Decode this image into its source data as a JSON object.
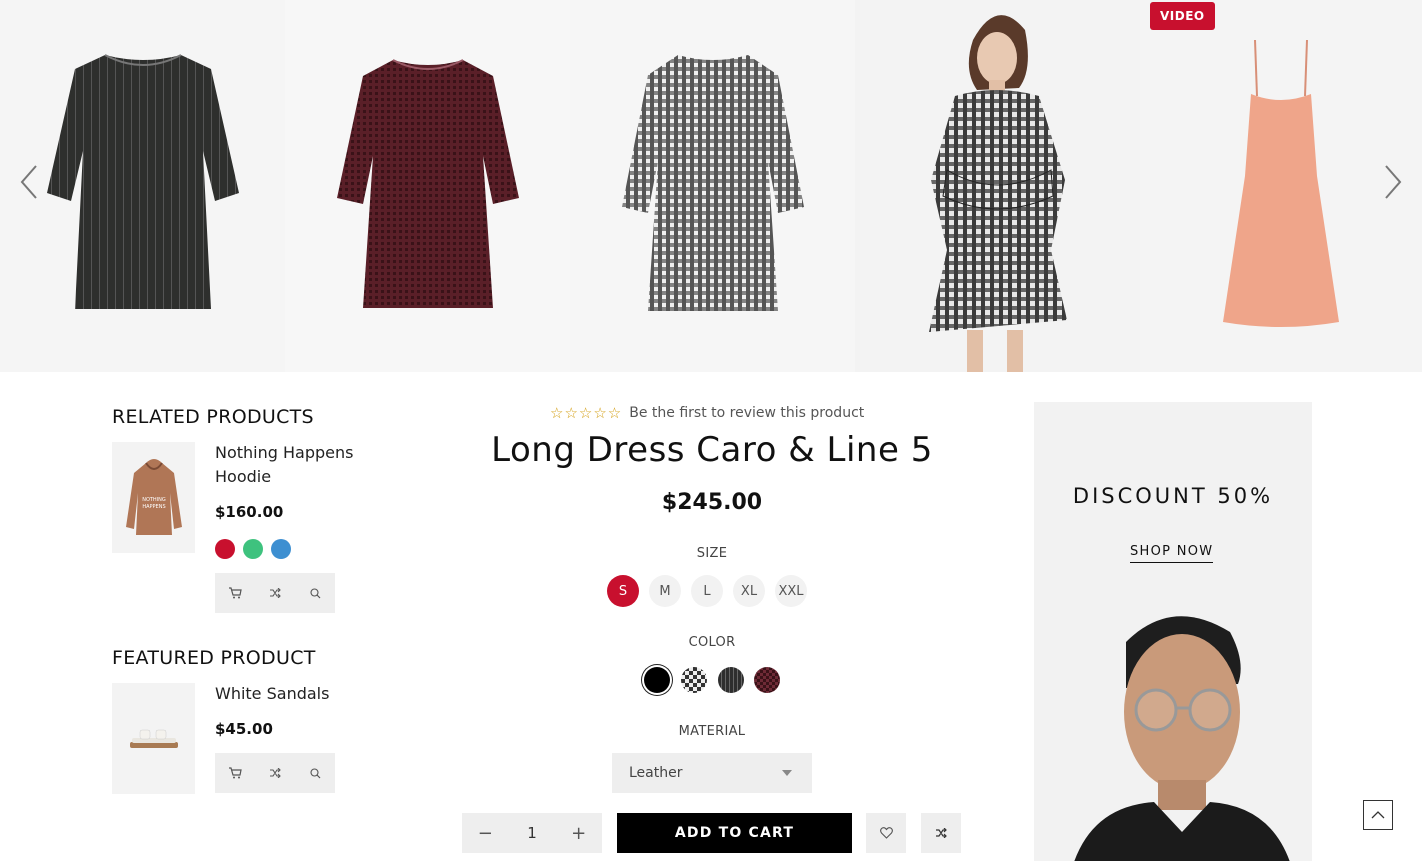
{
  "gallery": {
    "video_badge": "VIDEO",
    "slides": [
      "dress-black-stripe",
      "dress-burgundy-check",
      "dress-black-white-check",
      "model-in-check-dress",
      "dress-peach-slip"
    ]
  },
  "sidebar": {
    "related_title": "RELATED PRODUCTS",
    "related": {
      "name": "Nothing Happens Hoodie",
      "price": "$160.00",
      "swatches": [
        "#c8102e",
        "#3ec27e",
        "#3d8fd1"
      ],
      "hoodie_print": "NOTHING HAPPENS"
    },
    "featured_title": "FEATURED PRODUCT",
    "featured": {
      "name": "White Sandals",
      "price": "$45.00"
    }
  },
  "product": {
    "stars": "☆☆☆☆☆",
    "review_text": "Be the first to review this product",
    "title": "Long Dress Caro & Line 5",
    "price": "$245.00",
    "size_label": "SIZE",
    "sizes": [
      "S",
      "M",
      "L",
      "XL",
      "XXL"
    ],
    "selected_size": "S",
    "color_label": "COLOR",
    "colors": [
      "black",
      "black-white-check",
      "black-stripe",
      "burgundy-check"
    ],
    "material_label": "MATERIAL",
    "material_value": "Leather",
    "quantity": "1",
    "qty_minus": "−",
    "qty_plus": "+",
    "add_to_cart": "ADD TO CART"
  },
  "banner": {
    "discount": "DISCOUNT 50%",
    "shop_now": "SHOP NOW"
  },
  "colors": {
    "accent": "#c8102e",
    "button_dark": "#000000",
    "panel_gray": "#eeeeee"
  }
}
